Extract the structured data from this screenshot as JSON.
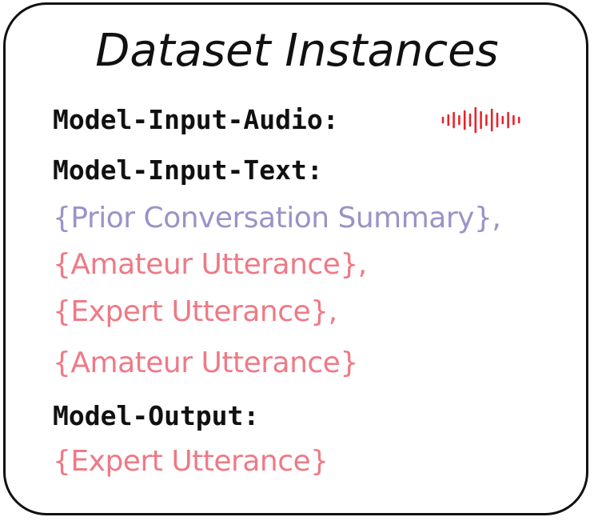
{
  "title": "Dataset Instances",
  "labels": {
    "input_audio": "Model-Input-Audio:",
    "input_text": "Model-Input-Text:",
    "output": "Model-Output:"
  },
  "input_text_items": [
    {
      "text": "{Prior Conversation Summary},",
      "color": "#9b93c7"
    },
    {
      "text": "{Amateur Utterance},",
      "color": "#ee7a86"
    },
    {
      "text": "{Expert Utterance},",
      "color": "#ee7a86"
    },
    {
      "text": "{Amateur Utterance}",
      "color": "#ee7a86"
    }
  ],
  "output_item": {
    "text": "{Expert Utterance}",
    "color": "#ee7a86"
  },
  "icons": {
    "audio": "audio-waveform-icon"
  },
  "colors": {
    "waveform": "#e8232c",
    "border": "#111111"
  }
}
